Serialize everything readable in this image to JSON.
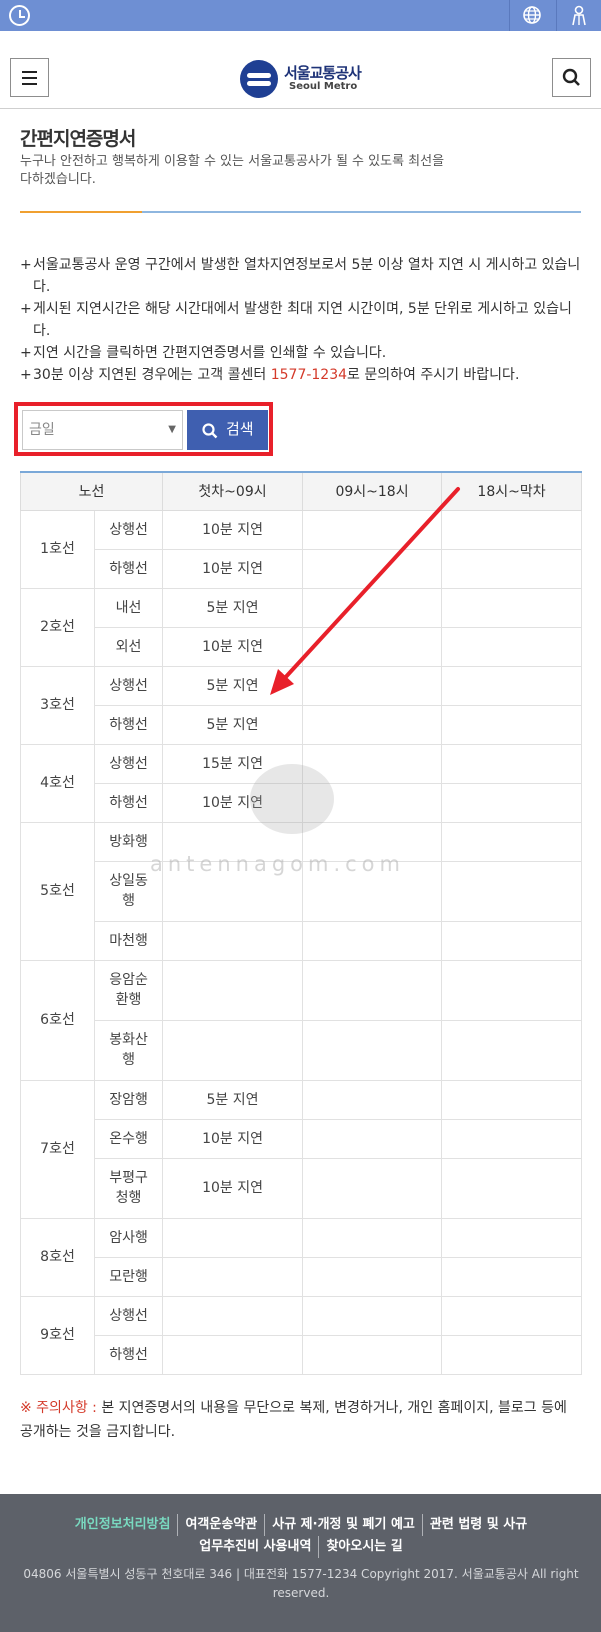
{
  "header": {
    "logo_kr": "서울교통공사",
    "logo_en": "Seoul Metro"
  },
  "page": {
    "title": "간편지연증명서",
    "description": "누구나 안전하고 행복하게 이용할 수 있는 서울교통공사가 될 수 있도록 최선을 다하겠습니다."
  },
  "notes": [
    {
      "text": "서울교통공사 운영 구간에서 발생한 열차지연정보로서 5분 이상 열차 지연 시 게시하고 있습니다."
    },
    {
      "text": "게시된 지연시간은 해당 시간대에서 발생한 최대 지연 시간이며, 5분 단위로 게시하고 있습니다."
    },
    {
      "text": "지연 시간을 클릭하면 간편지연증명서를 인쇄할 수 있습니다."
    },
    {
      "text_before": "30분 이상 지연된 경우에는 고객 콜센터 ",
      "phone": "1577-1234",
      "text_after": "로 문의하여 주시기 바랍니다."
    }
  ],
  "search": {
    "selected": "금일",
    "button_label": "검색"
  },
  "table": {
    "headers": [
      "노선",
      "첫차~09시",
      "09시~18시",
      "18시~막차"
    ],
    "lines": [
      {
        "name": "1호선",
        "rows": [
          {
            "dir": "상행선",
            "t1": "10분 지연",
            "t2": "",
            "t3": ""
          },
          {
            "dir": "하행선",
            "t1": "10분 지연",
            "t2": "",
            "t3": ""
          }
        ]
      },
      {
        "name": "2호선",
        "rows": [
          {
            "dir": "내선",
            "t1": "5분 지연",
            "t2": "",
            "t3": ""
          },
          {
            "dir": "외선",
            "t1": "10분 지연",
            "t2": "",
            "t3": ""
          }
        ]
      },
      {
        "name": "3호선",
        "rows": [
          {
            "dir": "상행선",
            "t1": "5분 지연",
            "t2": "",
            "t3": ""
          },
          {
            "dir": "하행선",
            "t1": "5분 지연",
            "t2": "",
            "t3": ""
          }
        ]
      },
      {
        "name": "4호선",
        "rows": [
          {
            "dir": "상행선",
            "t1": "15분 지연",
            "t2": "",
            "t3": ""
          },
          {
            "dir": "하행선",
            "t1": "10분 지연",
            "t2": "",
            "t3": ""
          }
        ]
      },
      {
        "name": "5호선",
        "rows": [
          {
            "dir": "방화행",
            "t1": "",
            "t2": "",
            "t3": ""
          },
          {
            "dir": "상일동행",
            "t1": "",
            "t2": "",
            "t3": ""
          },
          {
            "dir": "마천행",
            "t1": "",
            "t2": "",
            "t3": ""
          }
        ]
      },
      {
        "name": "6호선",
        "rows": [
          {
            "dir": "응암순환행",
            "t1": "",
            "t2": "",
            "t3": ""
          },
          {
            "dir": "봉화산행",
            "t1": "",
            "t2": "",
            "t3": ""
          }
        ]
      },
      {
        "name": "7호선",
        "rows": [
          {
            "dir": "장암행",
            "t1": "5분 지연",
            "t2": "",
            "t3": ""
          },
          {
            "dir": "온수행",
            "t1": "10분 지연",
            "t2": "",
            "t3": ""
          },
          {
            "dir": "부평구청행",
            "t1": "10분 지연",
            "t2": "",
            "t3": ""
          }
        ]
      },
      {
        "name": "8호선",
        "rows": [
          {
            "dir": "암사행",
            "t1": "",
            "t2": "",
            "t3": ""
          },
          {
            "dir": "모란행",
            "t1": "",
            "t2": "",
            "t3": ""
          }
        ]
      },
      {
        "name": "9호선",
        "rows": [
          {
            "dir": "상행선",
            "t1": "",
            "t2": "",
            "t3": ""
          },
          {
            "dir": "하행선",
            "t1": "",
            "t2": "",
            "t3": ""
          }
        ]
      }
    ]
  },
  "watermark": "antennagom.com",
  "caution": {
    "label": "※ 주의사항 :",
    "text": " 본 지연증명서의 내용을 무단으로 복제, 변경하거나, 개인 홈페이지, 블로그 등에 공개하는 것을 금지합니다."
  },
  "footer": {
    "links": [
      "개인정보처리방침",
      "여객운송약관",
      "사규 제·개정 및 폐기 예고",
      "관련 법령 및 사규",
      "업무추진비 사용내역",
      "찾아오시는 길"
    ],
    "copyright": "04806 서울특별시 성동구 천호대로 346 | 대표전화 1577-1234 Copyright 2017. 서울교통공사 All right reserved."
  },
  "colors": {
    "topbar": "#6e8fd3",
    "primary_button": "#3f5fb0",
    "highlight_red": "#e8202a",
    "phone_red": "#d43a2a",
    "footer_bg": "#5d6169",
    "privacy_link": "#79d9c0"
  },
  "icons": [
    "clock-icon",
    "globe-icon",
    "person-icon",
    "hamburger-menu-icon",
    "search-icon",
    "seoul-metro-logo"
  ]
}
